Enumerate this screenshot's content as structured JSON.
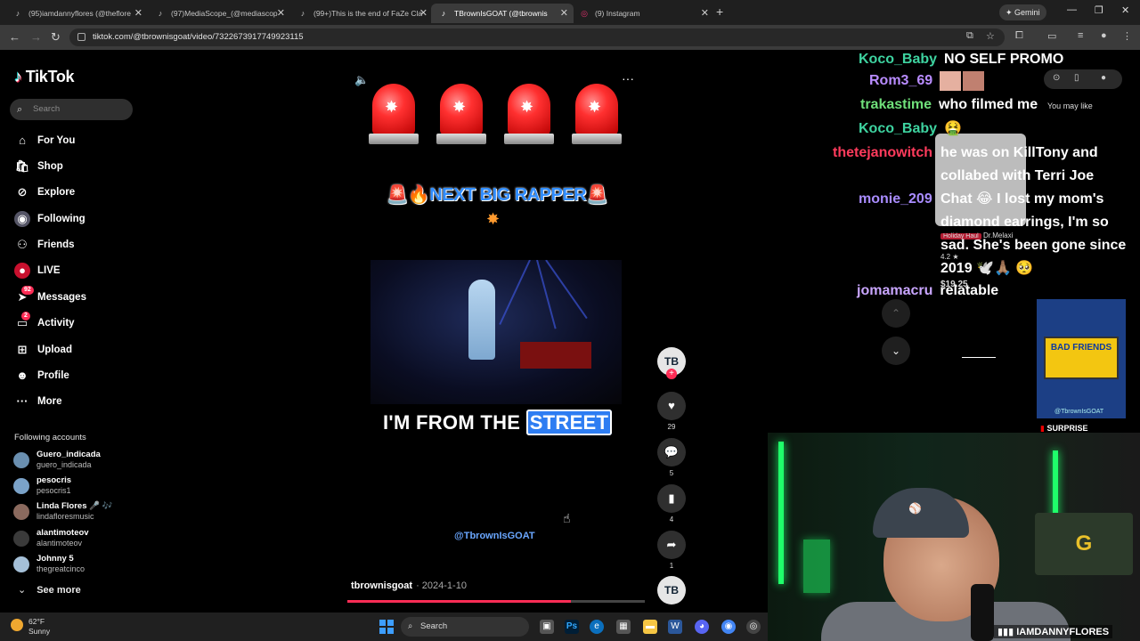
{
  "browser": {
    "tabs": [
      {
        "title": "(95)iamdannyflores (@theflore",
        "icon": "tiktok-icon",
        "active": false
      },
      {
        "title": "(97)MediaScope_(@mediascop",
        "icon": "tiktok-icon",
        "active": false
      },
      {
        "title": "(99+)This is the end of FaZe Cla",
        "icon": "tiktok-icon",
        "active": false
      },
      {
        "title": "TBrownIsGOAT (@tbrownis",
        "icon": "tiktok-icon",
        "active": true
      },
      {
        "title": "(9) Instagram",
        "icon": "instagram-icon",
        "active": false
      }
    ],
    "gemini_label": "Gemini",
    "url": "tiktok.com/@tbrownisgoat/video/7322673917749923115"
  },
  "tiktok": {
    "logo": "TikTok",
    "search_placeholder": "Search",
    "menu": [
      {
        "label": "For You",
        "icon": "home-icon",
        "badge": ""
      },
      {
        "label": "Shop",
        "icon": "shop-icon",
        "badge": ""
      },
      {
        "label": "Explore",
        "icon": "compass-icon",
        "badge": ""
      },
      {
        "label": "Following",
        "icon": "following-icon",
        "badge": ""
      },
      {
        "label": "Friends",
        "icon": "friends-icon",
        "badge": ""
      },
      {
        "label": "LIVE",
        "icon": "live-icon",
        "badge": ""
      },
      {
        "label": "Messages",
        "icon": "messages-icon",
        "badge": "92"
      },
      {
        "label": "Activity",
        "icon": "activity-icon",
        "badge": "2"
      },
      {
        "label": "Upload",
        "icon": "upload-icon",
        "badge": ""
      },
      {
        "label": "Profile",
        "icon": "profile-icon",
        "badge": ""
      },
      {
        "label": "More",
        "icon": "more-icon",
        "badge": ""
      }
    ],
    "following_title": "Following accounts",
    "accounts": [
      {
        "name": "Guero_indicada",
        "handle": "guero_indicada"
      },
      {
        "name": "pesocris",
        "handle": "pesocris1"
      },
      {
        "name": "Linda Flores 🎤 🎶",
        "handle": "lindafloresmusic"
      },
      {
        "name": "alantimoteov",
        "handle": "alantimoteov"
      },
      {
        "name": "Johnny 5",
        "handle": "thegreatcinco"
      }
    ],
    "see_more": "See more"
  },
  "video": {
    "caption_top": "🚨🔥NEXT BIG RAPPER🚨",
    "lyric_pre": "I'M FROM THE",
    "lyric_highlight": "STREET",
    "watermark": "@TbrownIsGOAT",
    "author": "tbrownisgoat",
    "date": "· 2024-1-10",
    "progress": 0.75,
    "actions": {
      "likes": "29",
      "comments": "5",
      "saves": "4",
      "shares": "1"
    },
    "avatar_text": "TB"
  },
  "chat": [
    {
      "user": "Koco_Baby",
      "text": "NO SELF PROMO",
      "color": "#3ed3a0"
    },
    {
      "user": "Rom3_69",
      "text": "",
      "color": "#b98cff"
    },
    {
      "user": "trakastime",
      "text": "who filmed me",
      "color": "#6fe07a"
    },
    {
      "user": "Koco_Baby",
      "text": "🤮",
      "color": "#3ed3a0"
    },
    {
      "user": "thetejanowitch",
      "text": "he was on KillTony and collabed with Terri Joe",
      "color": "#ff3b5c"
    },
    {
      "user": "monie_209",
      "text": "Chat 😂 I lost my mom's diamond earrings, I'm so sad. She's been gone since 2019 🕊️🙏🏽 🥺",
      "color": "#a98cff"
    },
    {
      "user": "jomamacru",
      "text": "relatable",
      "color": "#c9a6ff"
    }
  ],
  "recommend": {
    "you_may_like": "You may like",
    "holiday_tag": "Holiday Haul",
    "product_brand": "Dr.Melaxi",
    "rating": "4.2 ★",
    "price": "$19.25",
    "thumb_caption": "@TbrownIsGOAT",
    "thumb_board": "BAD FRIENDS",
    "surprise": "SURPRISE"
  },
  "webcam": {
    "handle": "IAMDANNYFLORES",
    "pack_logo": "G"
  },
  "taskbar": {
    "temp": "62°F",
    "condition": "Sunny",
    "search": "Search"
  }
}
